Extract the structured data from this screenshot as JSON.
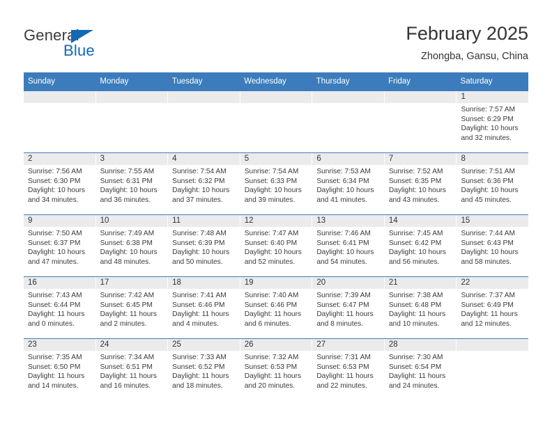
{
  "brand": {
    "name_top": "General",
    "name_bottom": "Blue",
    "triangle_color": "#1268b3",
    "text_color": "#3c3c3c"
  },
  "header": {
    "title": "February 2025",
    "subtitle": "Zhongba, Gansu, China"
  },
  "theme": {
    "header_blue": "#3c7cbc",
    "daynum_band": "#ebebeb",
    "text": "#333333"
  },
  "weekdays": [
    "Sunday",
    "Monday",
    "Tuesday",
    "Wednesday",
    "Thursday",
    "Friday",
    "Saturday"
  ],
  "weeks": [
    [
      {
        "day": "",
        "sunrise": "",
        "sunset": "",
        "daylight1": "",
        "daylight2": ""
      },
      {
        "day": "",
        "sunrise": "",
        "sunset": "",
        "daylight1": "",
        "daylight2": ""
      },
      {
        "day": "",
        "sunrise": "",
        "sunset": "",
        "daylight1": "",
        "daylight2": ""
      },
      {
        "day": "",
        "sunrise": "",
        "sunset": "",
        "daylight1": "",
        "daylight2": ""
      },
      {
        "day": "",
        "sunrise": "",
        "sunset": "",
        "daylight1": "",
        "daylight2": ""
      },
      {
        "day": "",
        "sunrise": "",
        "sunset": "",
        "daylight1": "",
        "daylight2": ""
      },
      {
        "day": "1",
        "sunrise": "Sunrise: 7:57 AM",
        "sunset": "Sunset: 6:29 PM",
        "daylight1": "Daylight: 10 hours",
        "daylight2": "and 32 minutes."
      }
    ],
    [
      {
        "day": "2",
        "sunrise": "Sunrise: 7:56 AM",
        "sunset": "Sunset: 6:30 PM",
        "daylight1": "Daylight: 10 hours",
        "daylight2": "and 34 minutes."
      },
      {
        "day": "3",
        "sunrise": "Sunrise: 7:55 AM",
        "sunset": "Sunset: 6:31 PM",
        "daylight1": "Daylight: 10 hours",
        "daylight2": "and 36 minutes."
      },
      {
        "day": "4",
        "sunrise": "Sunrise: 7:54 AM",
        "sunset": "Sunset: 6:32 PM",
        "daylight1": "Daylight: 10 hours",
        "daylight2": "and 37 minutes."
      },
      {
        "day": "5",
        "sunrise": "Sunrise: 7:54 AM",
        "sunset": "Sunset: 6:33 PM",
        "daylight1": "Daylight: 10 hours",
        "daylight2": "and 39 minutes."
      },
      {
        "day": "6",
        "sunrise": "Sunrise: 7:53 AM",
        "sunset": "Sunset: 6:34 PM",
        "daylight1": "Daylight: 10 hours",
        "daylight2": "and 41 minutes."
      },
      {
        "day": "7",
        "sunrise": "Sunrise: 7:52 AM",
        "sunset": "Sunset: 6:35 PM",
        "daylight1": "Daylight: 10 hours",
        "daylight2": "and 43 minutes."
      },
      {
        "day": "8",
        "sunrise": "Sunrise: 7:51 AM",
        "sunset": "Sunset: 6:36 PM",
        "daylight1": "Daylight: 10 hours",
        "daylight2": "and 45 minutes."
      }
    ],
    [
      {
        "day": "9",
        "sunrise": "Sunrise: 7:50 AM",
        "sunset": "Sunset: 6:37 PM",
        "daylight1": "Daylight: 10 hours",
        "daylight2": "and 47 minutes."
      },
      {
        "day": "10",
        "sunrise": "Sunrise: 7:49 AM",
        "sunset": "Sunset: 6:38 PM",
        "daylight1": "Daylight: 10 hours",
        "daylight2": "and 48 minutes."
      },
      {
        "day": "11",
        "sunrise": "Sunrise: 7:48 AM",
        "sunset": "Sunset: 6:39 PM",
        "daylight1": "Daylight: 10 hours",
        "daylight2": "and 50 minutes."
      },
      {
        "day": "12",
        "sunrise": "Sunrise: 7:47 AM",
        "sunset": "Sunset: 6:40 PM",
        "daylight1": "Daylight: 10 hours",
        "daylight2": "and 52 minutes."
      },
      {
        "day": "13",
        "sunrise": "Sunrise: 7:46 AM",
        "sunset": "Sunset: 6:41 PM",
        "daylight1": "Daylight: 10 hours",
        "daylight2": "and 54 minutes."
      },
      {
        "day": "14",
        "sunrise": "Sunrise: 7:45 AM",
        "sunset": "Sunset: 6:42 PM",
        "daylight1": "Daylight: 10 hours",
        "daylight2": "and 56 minutes."
      },
      {
        "day": "15",
        "sunrise": "Sunrise: 7:44 AM",
        "sunset": "Sunset: 6:43 PM",
        "daylight1": "Daylight: 10 hours",
        "daylight2": "and 58 minutes."
      }
    ],
    [
      {
        "day": "16",
        "sunrise": "Sunrise: 7:43 AM",
        "sunset": "Sunset: 6:44 PM",
        "daylight1": "Daylight: 11 hours",
        "daylight2": "and 0 minutes."
      },
      {
        "day": "17",
        "sunrise": "Sunrise: 7:42 AM",
        "sunset": "Sunset: 6:45 PM",
        "daylight1": "Daylight: 11 hours",
        "daylight2": "and 2 minutes."
      },
      {
        "day": "18",
        "sunrise": "Sunrise: 7:41 AM",
        "sunset": "Sunset: 6:46 PM",
        "daylight1": "Daylight: 11 hours",
        "daylight2": "and 4 minutes."
      },
      {
        "day": "19",
        "sunrise": "Sunrise: 7:40 AM",
        "sunset": "Sunset: 6:46 PM",
        "daylight1": "Daylight: 11 hours",
        "daylight2": "and 6 minutes."
      },
      {
        "day": "20",
        "sunrise": "Sunrise: 7:39 AM",
        "sunset": "Sunset: 6:47 PM",
        "daylight1": "Daylight: 11 hours",
        "daylight2": "and 8 minutes."
      },
      {
        "day": "21",
        "sunrise": "Sunrise: 7:38 AM",
        "sunset": "Sunset: 6:48 PM",
        "daylight1": "Daylight: 11 hours",
        "daylight2": "and 10 minutes."
      },
      {
        "day": "22",
        "sunrise": "Sunrise: 7:37 AM",
        "sunset": "Sunset: 6:49 PM",
        "daylight1": "Daylight: 11 hours",
        "daylight2": "and 12 minutes."
      }
    ],
    [
      {
        "day": "23",
        "sunrise": "Sunrise: 7:35 AM",
        "sunset": "Sunset: 6:50 PM",
        "daylight1": "Daylight: 11 hours",
        "daylight2": "and 14 minutes."
      },
      {
        "day": "24",
        "sunrise": "Sunrise: 7:34 AM",
        "sunset": "Sunset: 6:51 PM",
        "daylight1": "Daylight: 11 hours",
        "daylight2": "and 16 minutes."
      },
      {
        "day": "25",
        "sunrise": "Sunrise: 7:33 AM",
        "sunset": "Sunset: 6:52 PM",
        "daylight1": "Daylight: 11 hours",
        "daylight2": "and 18 minutes."
      },
      {
        "day": "26",
        "sunrise": "Sunrise: 7:32 AM",
        "sunset": "Sunset: 6:53 PM",
        "daylight1": "Daylight: 11 hours",
        "daylight2": "and 20 minutes."
      },
      {
        "day": "27",
        "sunrise": "Sunrise: 7:31 AM",
        "sunset": "Sunset: 6:53 PM",
        "daylight1": "Daylight: 11 hours",
        "daylight2": "and 22 minutes."
      },
      {
        "day": "28",
        "sunrise": "Sunrise: 7:30 AM",
        "sunset": "Sunset: 6:54 PM",
        "daylight1": "Daylight: 11 hours",
        "daylight2": "and 24 minutes."
      },
      {
        "day": "",
        "sunrise": "",
        "sunset": "",
        "daylight1": "",
        "daylight2": ""
      }
    ]
  ]
}
